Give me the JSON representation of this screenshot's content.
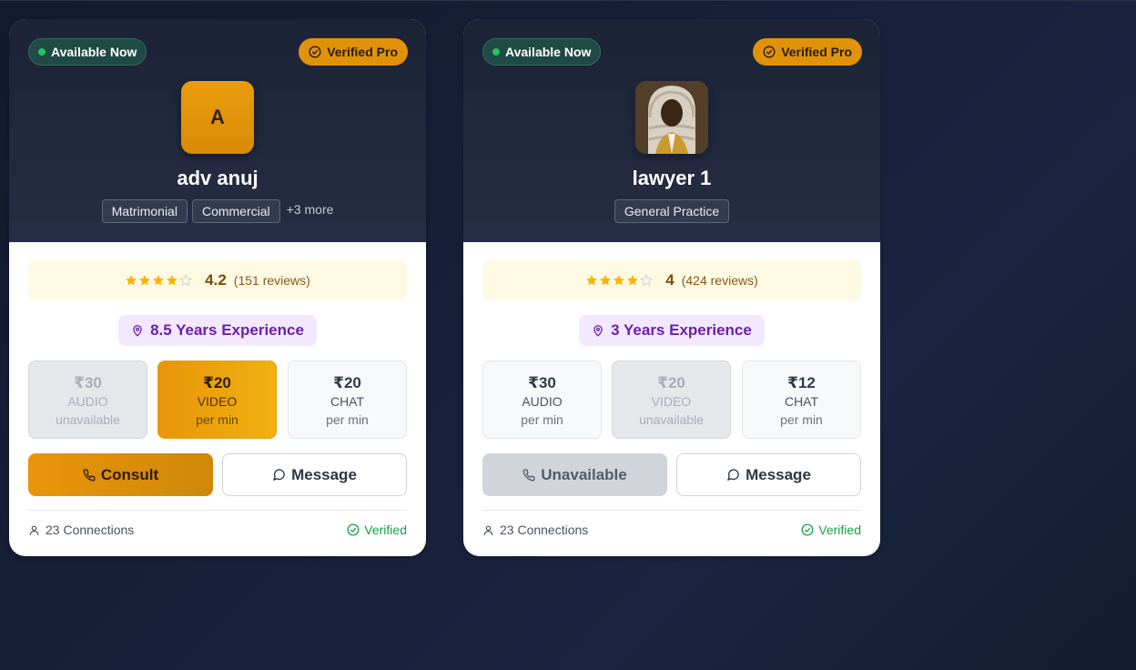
{
  "lawyers": [
    {
      "availability": "Available Now",
      "badge": "Verified Pro",
      "avatar_initial": "A",
      "name": "adv anuj",
      "tags": [
        "Matrimonial",
        "Commercial"
      ],
      "more_tags": "+3 more",
      "rating": "4.2",
      "reviews": "(151 reviews)",
      "experience": "8.5 Years Experience",
      "prices": [
        {
          "amount": "₹30",
          "type": "AUDIO",
          "unit": "unavailable",
          "state": "unavailable"
        },
        {
          "amount": "₹20",
          "type": "VIDEO",
          "unit": "per min",
          "state": "selected"
        },
        {
          "amount": "₹20",
          "type": "CHAT",
          "unit": "per min",
          "state": "available"
        }
      ],
      "primary_button": "Consult",
      "message_button": "Message",
      "connections": "23 Connections",
      "verified": "Verified"
    },
    {
      "availability": "Available Now",
      "badge": "Verified Pro",
      "avatar_image": "judge-wig-portrait",
      "name": "lawyer 1",
      "tags": [
        "General Practice"
      ],
      "rating": "4",
      "reviews": "(424 reviews)",
      "experience": "3 Years Experience",
      "prices": [
        {
          "amount": "₹30",
          "type": "AUDIO",
          "unit": "per min",
          "state": "available"
        },
        {
          "amount": "₹20",
          "type": "VIDEO",
          "unit": "unavailable",
          "state": "unavailable"
        },
        {
          "amount": "₹12",
          "type": "CHAT",
          "unit": "per min",
          "state": "available"
        }
      ],
      "primary_button": "Unavailable",
      "message_button": "Message",
      "connections": "23 Connections",
      "verified": "Verified"
    }
  ],
  "colors": {
    "accent": "#e8950a",
    "available_dot": "#22c55e",
    "verified_green": "#16a34a",
    "experience_purple": "#6b21a8",
    "star": "#f5b50a"
  },
  "icons": [
    "star-icon",
    "map-pin-icon",
    "phone-icon",
    "message-circle-icon",
    "user-icon",
    "check-circle-icon"
  ]
}
